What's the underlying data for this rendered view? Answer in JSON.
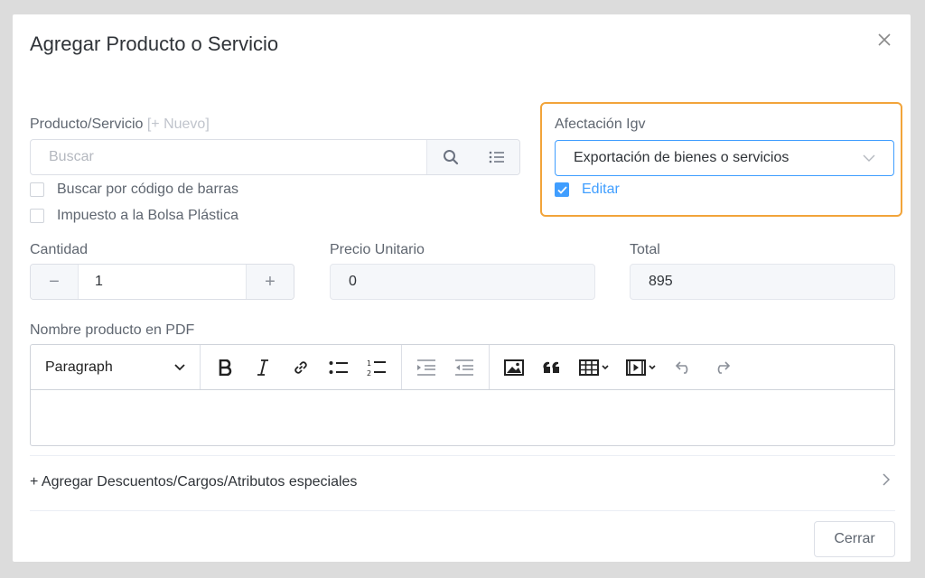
{
  "dialog": {
    "title": "Agregar Producto o Servicio"
  },
  "product": {
    "label": "Producto/Servicio",
    "new_link": "[+ Nuevo]",
    "search_placeholder": "Buscar",
    "barcode_label": "Buscar por código de barras",
    "plastic_tax_label": "Impuesto a la Bolsa Plástica"
  },
  "igv": {
    "label": "Afectación Igv",
    "selected": "Exportación de bienes o servicios",
    "edit_label": "Editar",
    "highlight_color": "#f2a43a"
  },
  "quantity": {
    "label": "Cantidad",
    "value": "1",
    "minus": "−",
    "plus": "+"
  },
  "unit_price": {
    "label": "Precio Unitario",
    "value": "0"
  },
  "total": {
    "label": "Total",
    "value": "895"
  },
  "pdf_name": {
    "label": "Nombre producto en PDF",
    "block_format": "Paragraph"
  },
  "extras": {
    "label": "+ Agregar Descuentos/Cargos/Atributos especiales"
  },
  "footer": {
    "close_label": "Cerrar"
  }
}
